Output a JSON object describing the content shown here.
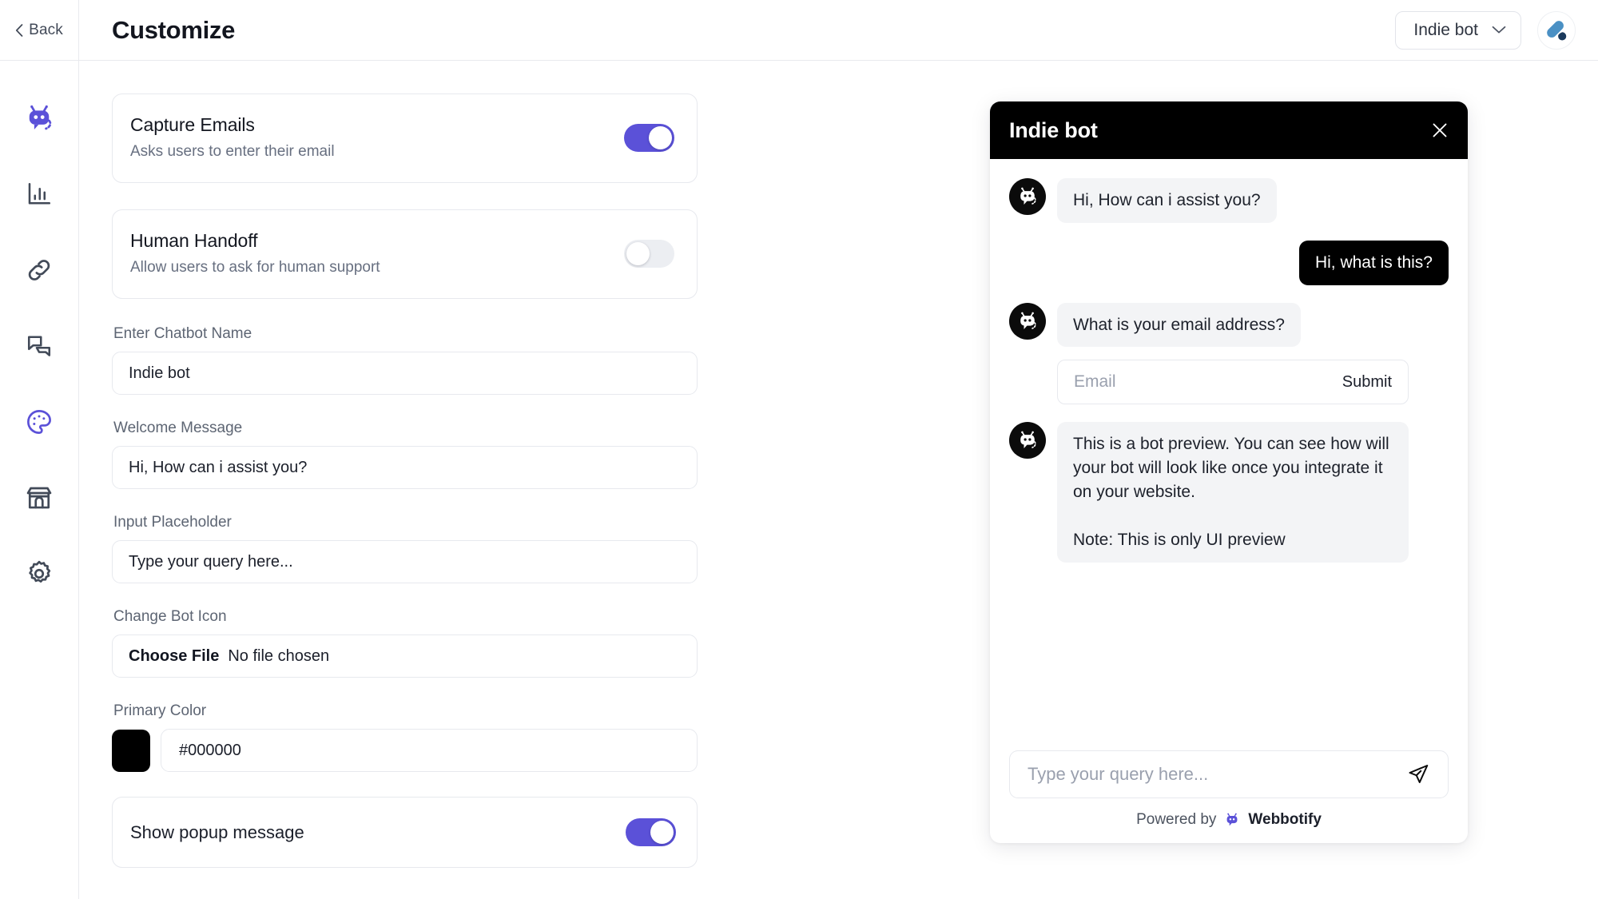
{
  "nav": {
    "back_label": "Back",
    "items": [
      {
        "name": "bot-logo",
        "icon": "robot-icon",
        "active": true
      },
      {
        "name": "analytics",
        "icon": "bar-chart-icon",
        "active": false
      },
      {
        "name": "links",
        "icon": "link-icon",
        "active": false
      },
      {
        "name": "conversations",
        "icon": "chat-bubbles-icon",
        "active": false
      },
      {
        "name": "customize",
        "icon": "palette-icon",
        "active": true
      },
      {
        "name": "marketplace",
        "icon": "store-icon",
        "active": false
      },
      {
        "name": "settings",
        "icon": "gear-icon",
        "active": false
      }
    ]
  },
  "header": {
    "title": "Customize",
    "bot_selector": {
      "value": "Indie bot",
      "chevron": "chevron-down-icon"
    },
    "avatar": "user-avatar"
  },
  "settings": {
    "capture_emails": {
      "title": "Capture Emails",
      "subtitle": "Asks users to enter their email",
      "enabled": true
    },
    "human_handoff": {
      "title": "Human Handoff",
      "subtitle": "Allow users to ask for human support",
      "enabled": false
    },
    "chatbot_name": {
      "label": "Enter Chatbot Name",
      "value": "Indie bot"
    },
    "welcome_message": {
      "label": "Welcome Message",
      "value": "Hi, How can i assist you?"
    },
    "input_placeholder": {
      "label": "Input Placeholder",
      "value": "Type your query here..."
    },
    "bot_icon": {
      "label": "Change Bot Icon",
      "choose_label": "Choose File",
      "file_status": "No file chosen"
    },
    "primary_color": {
      "label": "Primary Color",
      "value": "#000000",
      "swatch": "#000000"
    },
    "show_popup": {
      "title": "Show popup message",
      "enabled": true
    }
  },
  "preview": {
    "title": "Indie bot",
    "close_icon": "close-icon",
    "messages": [
      {
        "role": "bot",
        "text": "Hi, How can i assist you?"
      },
      {
        "role": "user",
        "text": "Hi, what is this?"
      },
      {
        "role": "bot",
        "text": "What is your email address?"
      }
    ],
    "email_capture": {
      "placeholder": "Email",
      "submit_label": "Submit"
    },
    "preview_note": "This is a bot preview. You can see how will your bot will look like once you integrate it on your website.\n\nNote: This is only UI preview",
    "input_placeholder": "Type your query here...",
    "send_icon": "send-icon",
    "powered_by_prefix": "Powered by",
    "powered_by_brand": "Webbotify"
  },
  "colors": {
    "accent": "#5b51d8",
    "toggle_off": "#eceef2",
    "panel_header": "#000000",
    "bubble_bot": "#f3f4f6",
    "bubble_user": "#000000",
    "border": "#e7e9ee"
  }
}
